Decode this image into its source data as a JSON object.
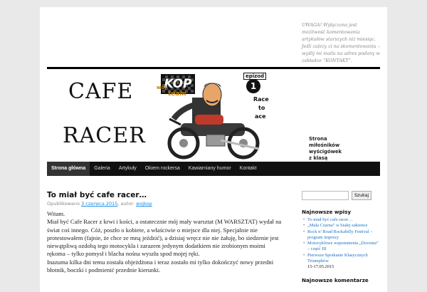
{
  "notice": {
    "text": "UWAGA! Wyłączona jest możliwość komentowania artykułów starszych niż miesiąc. Jeśli zależy ci na skomentowaniu – wyślij mi maila na adres podany w zakładce “KONTAKT”."
  },
  "header": {
    "brand_line1": "CAFE",
    "brand_line2": "RACER",
    "art": {
      "kop": "KOP",
      "woj": "woj",
      "team": "team",
      "epizod": "epizod",
      "episode_number": "1",
      "race_words": [
        "Race",
        "to",
        "ace"
      ]
    },
    "tagline_lines": [
      "Strona miłośników",
      "wyścigówek",
      "z klasą"
    ]
  },
  "nav": {
    "items": [
      {
        "label": "Strona główna",
        "active": true
      },
      {
        "label": "Galeria"
      },
      {
        "label": "Artykuły"
      },
      {
        "label": "Okiem rockersa"
      },
      {
        "label": "Kawiarniany humor"
      },
      {
        "label": "Kontakt"
      }
    ]
  },
  "post": {
    "title": "To miał być cafe racer…",
    "meta_prefix": "Opublikowano ",
    "date": "3 czerwca 2015",
    "meta_author_prefix": ", autor: ",
    "author": "wojkop",
    "paragraphs": [
      "Witam.",
      "Miał być Cafe Racer z krwi i kości, a ostatecznie mój mały warsztat (M WARSZTAT) wydał na świat coś innego. Cóż, poszło o kobiete, a właściwie o miejsce dla niej. Specjalnie nie protestowałem (fajnie, że chce ze mną jeździć), a dzisiaj wręcz nie nie żałuję, bo siedzenie jest niewątpliwą ozdobą tego motocykla i zarazem jedynym dodatkiem nie zrobionym moimi rękoma – tylko pomysł i blacha nośna wyszła spod mojej ręki.",
      "Inazuma kilka dni temu została objeżdżona i teraz zostało mi tylko dokończyć nowy przedni błotnik, boczki i podmienić przednie kierunki."
    ]
  },
  "sidebar": {
    "search": {
      "value": "",
      "button_label": "Szukaj"
    },
    "recent_title": "Najnowsze wpisy",
    "recent_posts": [
      {
        "label": "To miał być cafe racer…",
        "link": true
      },
      {
        "label": "„Mała Czarna” w białej sukience",
        "link": true
      },
      {
        "label": "Rock n’ Road Rockabilly Festival – program imprezy",
        "link": true
      },
      {
        "label": "Motocyklowe wspomnienia „Docenta” – część III",
        "link": true
      },
      {
        "label": "Pierwsze Spotkanie Klasycznych Triumphów",
        "link": true
      },
      {
        "label": "15-17.05.2015",
        "link": false
      }
    ],
    "comments_title": "Najnowsze komentarze"
  },
  "colors": {
    "link": "#1b6fc4",
    "nav_background": "#111111",
    "page_background": "#e9e9e9"
  }
}
